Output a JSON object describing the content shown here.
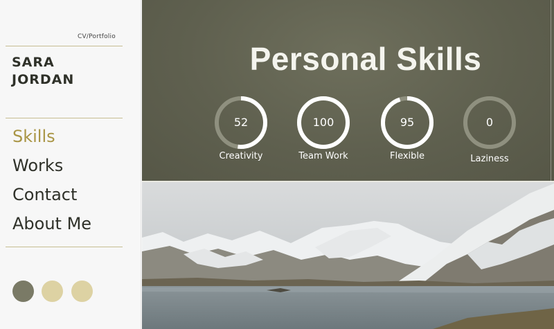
{
  "sidebar": {
    "tag": "CV/Portfolio",
    "name": [
      "SARA",
      "JORDAN"
    ],
    "nav": [
      "Skills",
      "Works",
      "Contact",
      "About Me"
    ],
    "active_nav": "Skills",
    "swatches": [
      {
        "label": "theme-olive",
        "color": "#7a7a66"
      },
      {
        "label": "theme-sand",
        "color": "#ddd2a3"
      },
      {
        "label": "theme-sand-2",
        "color": "#ddd2a3"
      }
    ],
    "rule_color": "#c7bd92",
    "accent": "#a99545"
  },
  "hero": {
    "title": "Personal Skills",
    "skills": [
      {
        "label": "Creativity",
        "value": 52
      },
      {
        "label": "Team Work",
        "value": 100
      },
      {
        "label": "Flexible",
        "value": 95
      },
      {
        "label": "Laziness",
        "value": 0
      }
    ],
    "ring_track_color": "#8f907f",
    "ring_fill_color": "#ffffff"
  },
  "landscape": {
    "subject": "snow-capped mountains over a lake"
  }
}
